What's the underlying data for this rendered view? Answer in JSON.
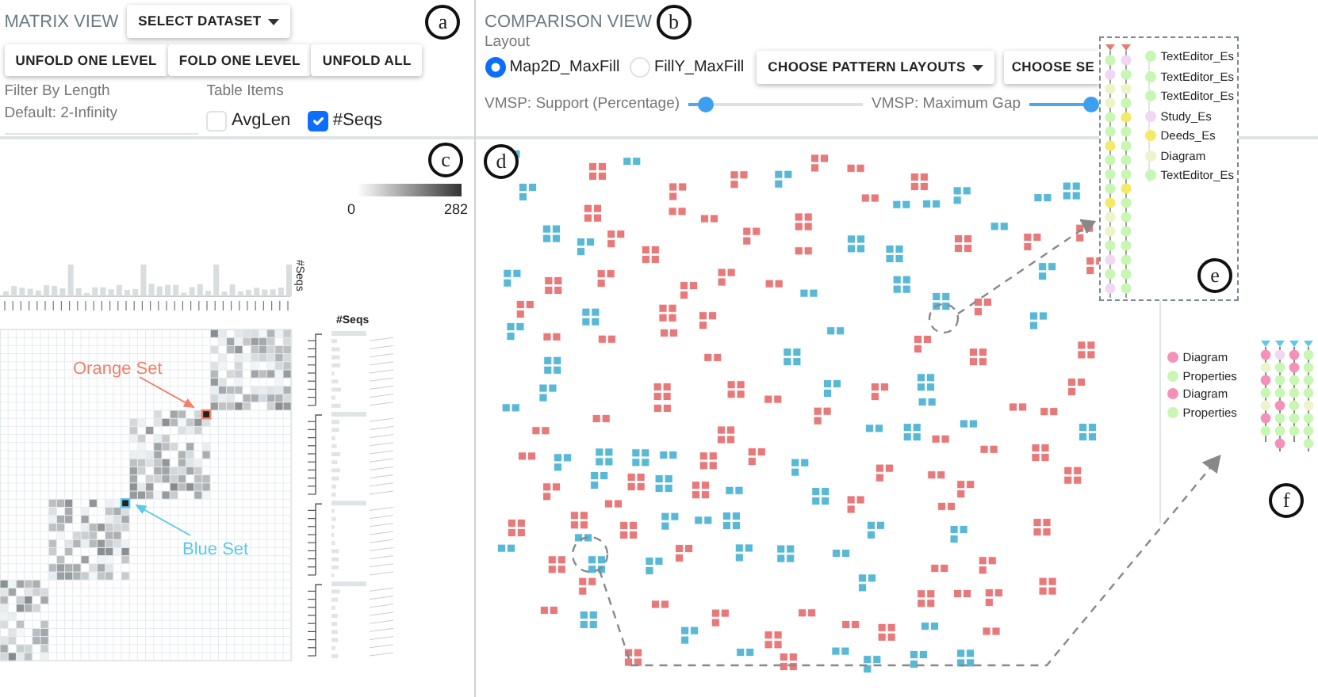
{
  "matrix_view": {
    "title": "MATRIX VIEW",
    "marker": "a",
    "dataset_button": "SELECT DATASET",
    "buttons": [
      "UNFOLD ONE LEVEL",
      "FOLD ONE LEVEL",
      "UNFOLD ALL"
    ],
    "filter": {
      "label": "Filter By Length",
      "value": "Default: 2-Infinity"
    },
    "table_items": {
      "label": "Table Items",
      "items": [
        {
          "label": "AvgLen",
          "checked": false
        },
        {
          "label": "#Seqs",
          "checked": true
        }
      ]
    },
    "matrix": {
      "marker": "c",
      "legend_min": "0",
      "legend_max": "282",
      "seqs_axis_label": "#Seqs",
      "seqs_column_label": "#Seqs",
      "annotations": [
        {
          "label": "Orange Set",
          "color": "#f0806c"
        },
        {
          "label": "Blue Set",
          "color": "#5cc8ea"
        }
      ]
    }
  },
  "comparison_view": {
    "title": "COMPARISON VIEW",
    "marker": "b",
    "layout_label": "Layout",
    "layouts": [
      {
        "label": "Map2D_MaxFill",
        "selected": true
      },
      {
        "label": "FillY_MaxFill",
        "selected": false
      }
    ],
    "buttons": [
      "CHOOSE PATTERN LAYOUTS",
      "CHOOSE SE"
    ],
    "sliders": [
      {
        "label": "VMSP: Support (Percentage)",
        "level": 0.1
      },
      {
        "label": "VMSP: Maximum Gap",
        "level": 1
      }
    ],
    "canvas_marker": "d"
  },
  "inset_e": {
    "marker": "e",
    "items": [
      {
        "label": "TextEditor_Es",
        "color": "#c8f7b4"
      },
      {
        "label": "TextEditor_Es",
        "color": "#c8f7b4"
      },
      {
        "label": "TextEditor_Es",
        "color": "#c8f7b4"
      },
      {
        "label": "Study_Es",
        "color": "#f0d8f2"
      },
      {
        "label": "Deeds_Es",
        "color": "#f5e96a"
      },
      {
        "label": "Diagram",
        "color": "#eef3cc"
      },
      {
        "label": "TextEditor_Es",
        "color": "#c8f7b4"
      }
    ]
  },
  "inset_f": {
    "marker": "f",
    "items": [
      {
        "label": "Diagram",
        "color": "#f590b8"
      },
      {
        "label": "Properties",
        "color": "#c8f7b4"
      },
      {
        "label": "Diagram",
        "color": "#f590b8"
      },
      {
        "label": "Properties",
        "color": "#c8f7b4"
      }
    ]
  }
}
